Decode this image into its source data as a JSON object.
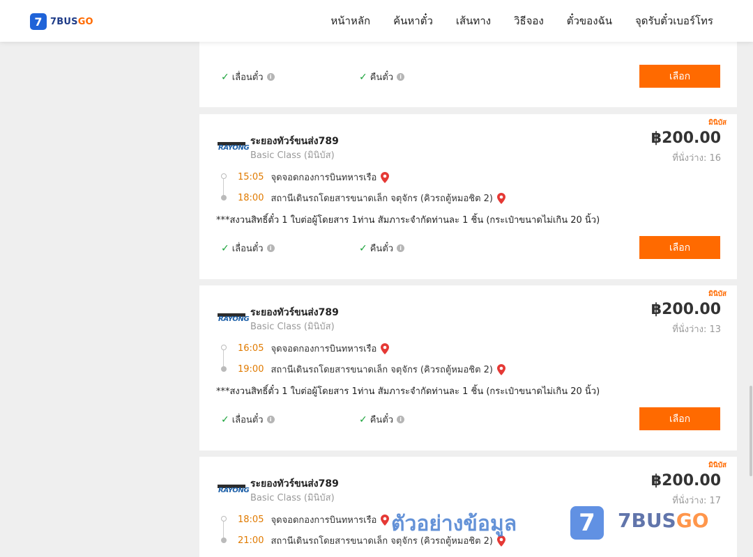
{
  "header": {
    "logo_badge": "7",
    "logo_text_main": "7BUS",
    "logo_text_accent": "GO",
    "nav": [
      "หน้าหลัก",
      "ค้นหาตั๋ว",
      "เส้นทาง",
      "วิธีจอง",
      "ตั๋วของฉัน",
      "จุดรับตั๋วเบอร์โทร"
    ]
  },
  "top_card": {
    "reschedule_label": "เลื่อนตั๋ว",
    "refund_label": "คืนตั๋ว",
    "select_label": "เลือก"
  },
  "trips": [
    {
      "bus_type": "มินิบัส",
      "company_logo_text": "RAYONG",
      "company": "ระยองทัวร์ขนส่ง789",
      "bus_class": "Basic Class (มินิบัส)",
      "price": "฿200.00",
      "seats": "ที่นั่งว่าง: 16",
      "depart_time": "15:05",
      "depart_place": "จุดจอดกองการบินทหารเรือ",
      "arrive_time": "18:00",
      "arrive_place": "สถานีเดินรถโดยสารขนาดเล็ก จตุจักร (คิวรถตู้หมอชิต 2)",
      "note": "***สงวนสิทธิ์ตั๋ว 1 ใบต่อผู้โดยสาร 1ท่าน สัมภาระจำกัดท่านละ 1 ชิ้น (กระเป๋าขนาดไม่เกิน 20 นิ้ว)",
      "reschedule_label": "เลื่อนตั๋ว",
      "refund_label": "คืนตั๋ว",
      "select_label": "เลือก"
    },
    {
      "bus_type": "มินิบัส",
      "company_logo_text": "RAYONG",
      "company": "ระยองทัวร์ขนส่ง789",
      "bus_class": "Basic Class (มินิบัส)",
      "price": "฿200.00",
      "seats": "ที่นั่งว่าง: 13",
      "depart_time": "16:05",
      "depart_place": "จุดจอดกองการบินทหารเรือ",
      "arrive_time": "19:00",
      "arrive_place": "สถานีเดินรถโดยสารขนาดเล็ก จตุจักร (คิวรถตู้หมอชิต 2)",
      "note": "***สงวนสิทธิ์ตั๋ว 1 ใบต่อผู้โดยสาร 1ท่าน สัมภาระจำกัดท่านละ 1 ชิ้น (กระเป๋าขนาดไม่เกิน 20 นิ้ว)",
      "reschedule_label": "เลื่อนตั๋ว",
      "refund_label": "คืนตั๋ว",
      "select_label": "เลือก"
    },
    {
      "bus_type": "มินิบัส",
      "company_logo_text": "RAYONG",
      "company": "ระยองทัวร์ขนส่ง789",
      "bus_class": "Basic Class (มินิบัส)",
      "price": "฿200.00",
      "seats": "ที่นั่งว่าง: 17",
      "depart_time": "18:05",
      "depart_place": "จุดจอดกองการบินทหารเรือ",
      "arrive_time": "21:00",
      "arrive_place": "สถานีเดินรถโดยสารขนาดเล็ก จตุจักร (คิวรถตู้หมอชิต 2)"
    }
  ],
  "watermark": {
    "text": "ตัวอย่างข้อมูล",
    "badge": "7",
    "brand_main": "7BUS",
    "brand_accent": "GO"
  }
}
